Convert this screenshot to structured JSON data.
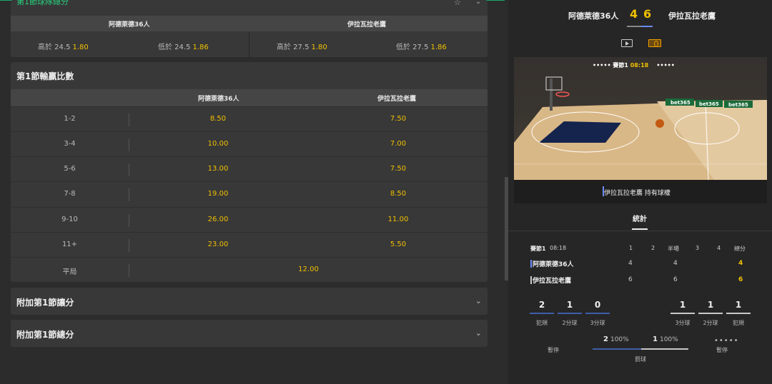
{
  "totals": {
    "title": "第1節球隊總分",
    "home_team": "阿德萊德36人",
    "away_team": "伊拉瓦拉老鷹",
    "cells": [
      {
        "label": "高於 24.5",
        "odds": "1.80"
      },
      {
        "label": "低於 24.5",
        "odds": "1.86"
      },
      {
        "label": "高於 27.5",
        "odds": "1.80"
      },
      {
        "label": "低於 27.5",
        "odds": "1.86"
      }
    ]
  },
  "margin": {
    "title": "第1節輸贏比數",
    "home_team": "阿德萊德36人",
    "away_team": "伊拉瓦拉老鷹",
    "rows": [
      {
        "label": "1-2",
        "home": "8.50",
        "away": "7.50"
      },
      {
        "label": "3-4",
        "home": "10.00",
        "away": "7.00"
      },
      {
        "label": "5-6",
        "home": "13.00",
        "away": "7.50"
      },
      {
        "label": "7-8",
        "home": "19.00",
        "away": "8.50"
      },
      {
        "label": "9-10",
        "home": "26.00",
        "away": "11.00"
      },
      {
        "label": "11+",
        "home": "23.00",
        "away": "5.50"
      }
    ],
    "draw_label": "平局",
    "draw_odds": "12.00"
  },
  "extra_spread": {
    "title": "附加第1節讓分"
  },
  "extra_total": {
    "title": "附加第1節總分"
  },
  "scoreboard": {
    "home_team": "阿德萊德36人",
    "away_team": "伊拉瓦拉老鷹",
    "home_score": "4",
    "away_score": "6"
  },
  "court": {
    "quarter": "賽節1",
    "clock": "08:18",
    "dots": "••••• ",
    "dots_right": "•••••",
    "possession": "伊拉瓦拉老鷹 持有球權",
    "ads": [
      "bet365",
      "bet365",
      "bet365"
    ]
  },
  "stats": {
    "tab": "統計",
    "quarter": "賽節1",
    "clock": "08:18",
    "columns": [
      "1",
      "2",
      "半場",
      "3",
      "4",
      "總分"
    ],
    "home": {
      "name": "阿德萊德36人",
      "q1": "4",
      "half": "4",
      "total": "4"
    },
    "away": {
      "name": "伊拉瓦拉老鷹",
      "q1": "6",
      "half": "6",
      "total": "6"
    },
    "home_fouls": "2",
    "home_2pt": "1",
    "home_3pt": "0",
    "away_3pt": "1",
    "away_2pt": "1",
    "away_fouls": "1",
    "lbl_fouls": "犯規",
    "lbl_2pt": "2分球",
    "lbl_3pt": "3分球",
    "timeout_label": "暫停",
    "home_timeouts": "•••••",
    "ft_home": "2",
    "ft_home_pct": "100%",
    "ft_away": "1",
    "ft_away_pct": "100%",
    "ft_label": "罰球"
  },
  "colors": {
    "accent": "#f0c000",
    "home": "#6a8cff",
    "away": "#c8c8c8",
    "brand": "#26d07c"
  }
}
